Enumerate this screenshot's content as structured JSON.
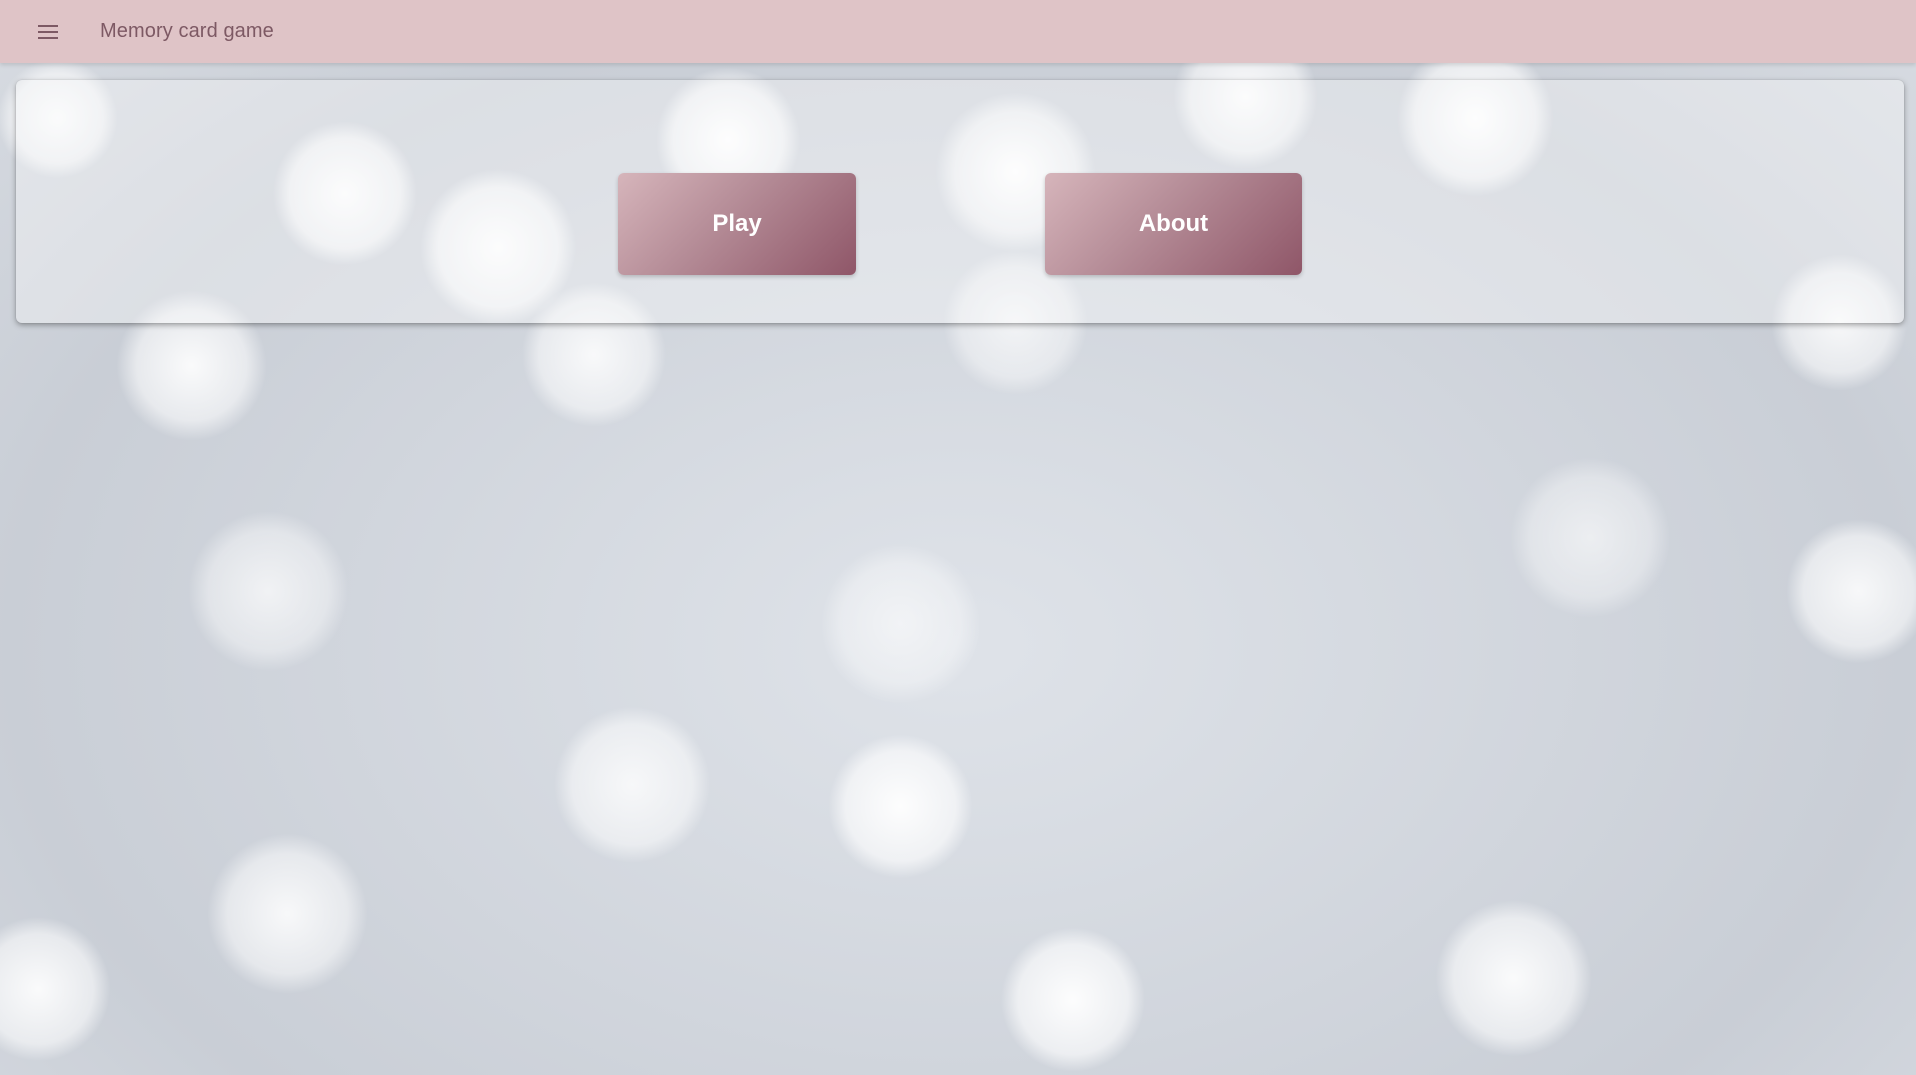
{
  "app_bar": {
    "title": "Memory card game",
    "menu_icon": "menu-icon",
    "background_color": "#dfc4c7",
    "title_color": "#7d5964"
  },
  "main_card": {
    "buttons": {
      "play_label": "Play",
      "about_label": "About"
    },
    "button_gradient": [
      "#d6b5bb",
      "#8f5668"
    ]
  }
}
